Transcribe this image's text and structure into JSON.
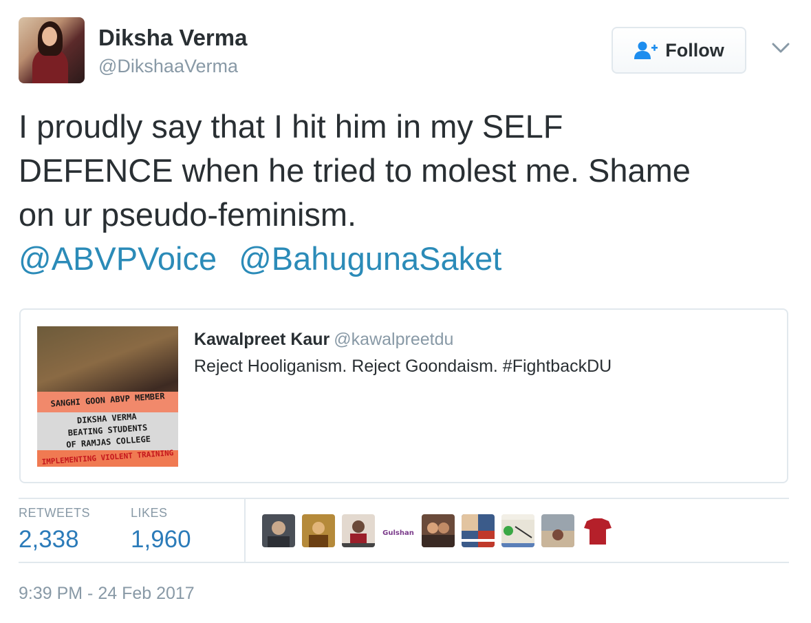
{
  "author": {
    "name": "Diksha Verma",
    "handle": "@DikshaaVerma",
    "avatar_icon": "profile-photo"
  },
  "follow_button": {
    "label": "Follow",
    "icon": "add-user-icon"
  },
  "tweet": {
    "lines": [
      "I proudly say that I hit him in my SELF",
      "DEFENCE when he tried to molest me. Shame",
      "on ur pseudo-feminism."
    ],
    "mentions": [
      "@ABVPVoice",
      "@BahugunaSaket"
    ]
  },
  "quoted_tweet": {
    "name": "Kawalpreet Kaur",
    "handle": "@kawalpreetdu",
    "text": "Reject Hooliganism. Reject Goondaism. #FightbackDU",
    "image_caption": {
      "line1": "SANGHI GOON ABVP MEMBER",
      "line2": "DIKSHA VERMA",
      "line3": "BEATING STUDENTS",
      "line4": "OF RAMJAS COLLEGE",
      "line5": "IMPLEMENTING VIOLENT TRAINING"
    }
  },
  "stats": {
    "retweets_label": "RETWEETS",
    "retweets_value": "2,338",
    "likes_label": "LIKES",
    "likes_value": "1,960"
  },
  "likers": [
    {
      "color": "#4a4f57"
    },
    {
      "color": "#b58a3a"
    },
    {
      "color": "#e3d9cf"
    },
    {
      "color": "#ffffff"
    },
    {
      "color": "#6a4a3a"
    },
    {
      "color": "#3b5b8a"
    },
    {
      "color": "#e8e4d8"
    },
    {
      "color": "#9aa4ad"
    },
    {
      "color": "#ffffff"
    }
  ],
  "timestamp": "9:39 PM - 24 Feb 2017",
  "colors": {
    "link": "#2b8bb8",
    "stat_value": "#2b7bb9",
    "muted": "#8899a6",
    "text": "#292f33"
  }
}
